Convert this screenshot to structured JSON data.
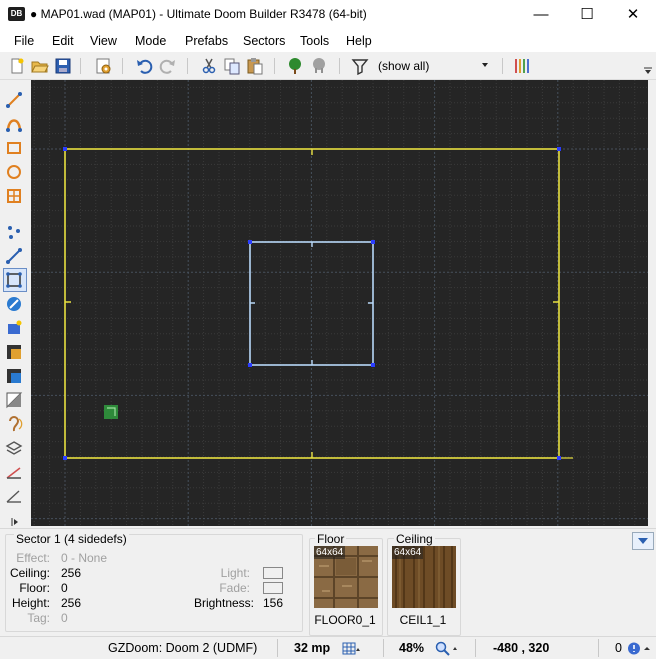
{
  "window": {
    "title": "● MAP01.wad (MAP01) - Ultimate Doom Builder R3478 (64-bit)",
    "logo": "DB",
    "minimize": "—",
    "maximize": "☐",
    "close": "✕"
  },
  "menu": [
    "File",
    "Edit",
    "View",
    "Mode",
    "Prefabs",
    "Sectors",
    "Tools",
    "Help"
  ],
  "toolbar": {
    "filter_value": "(show all)",
    "icons": [
      "new-map-icon",
      "open-map-icon",
      "save-map-icon",
      "map-options-icon",
      "undo-icon",
      "redo-icon",
      "cut-icon",
      "copy-icon",
      "paste-icon",
      "things-filter-tree-icon",
      "things-filter-gray-icon",
      "filter-funnel-icon",
      "linedef-colors-icon"
    ]
  },
  "left_tools": [
    "draw-line-icon",
    "draw-curve-icon",
    "draw-rectangle-icon",
    "draw-ellipse-icon",
    "draw-grid-icon",
    "vertices-mode-icon",
    "linedefs-mode-icon",
    "sectors-mode-icon",
    "things-mode-icon",
    "visual-mode-icon",
    "make-sector-icon",
    "make-sector-alt-icon",
    "gradient-brightness-icon",
    "sound-propagation-icon",
    "layers-icon",
    "slope-icon",
    "angle-icon"
  ],
  "map": {
    "colors": {
      "background": "#252525",
      "grid": "#3a3a3a",
      "grid_major": "#46505c",
      "outer_lines": "#e8e040",
      "inner_lines": "#b8d8f8",
      "vertex": "#2a3cff",
      "thing": "#2e8a3a"
    }
  },
  "info": {
    "sector_title": "Sector 1 (4 sidedefs)",
    "effect_label": "Effect:",
    "effect_value": "0 - None",
    "ceiling_label": "Ceiling:",
    "ceiling_value": "256",
    "floor_label": "Floor:",
    "floor_value": "0",
    "height_label": "Height:",
    "height_value": "256",
    "tag_label": "Tag:",
    "tag_value": "0",
    "light_label": "Light:",
    "fade_label": "Fade:",
    "brightness_label": "Brightness:",
    "brightness_value": "156",
    "floor_tex_title": "Floor",
    "floor_tex_size": "64x64",
    "floor_tex_name": "FLOOR0_1",
    "ceiling_tex_title": "Ceiling",
    "ceiling_tex_size": "64x64",
    "ceiling_tex_name": "CEIL1_1"
  },
  "status": {
    "engine": "GZDoom: Doom 2 (UDMF)",
    "grid": "32 mp",
    "zoom": "48%",
    "coords": "-480 , 320",
    "count": "0"
  }
}
